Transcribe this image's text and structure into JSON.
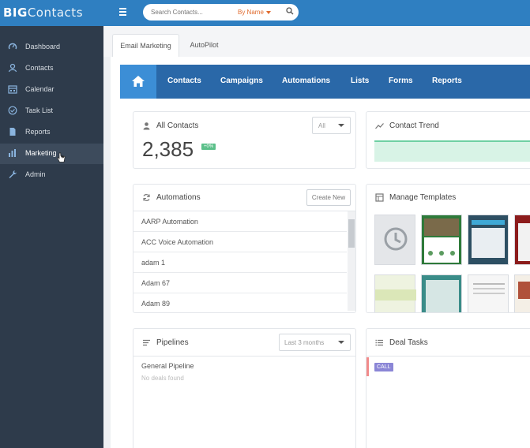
{
  "app": {
    "logo_bold": "BIG",
    "logo_rest": "Contacts"
  },
  "search": {
    "placeholder": "Search Contacts...",
    "by_label": "By Name"
  },
  "sidebar": {
    "items": [
      {
        "label": "Dashboard",
        "icon": "dashboard-icon"
      },
      {
        "label": "Contacts",
        "icon": "contacts-icon"
      },
      {
        "label": "Calendar",
        "icon": "calendar-icon"
      },
      {
        "label": "Task List",
        "icon": "task-check-icon"
      },
      {
        "label": "Reports",
        "icon": "document-icon"
      },
      {
        "label": "Marketing",
        "icon": "bar-chart-icon"
      },
      {
        "label": "Admin",
        "icon": "wrench-icon"
      }
    ],
    "active_index": 5
  },
  "tabs": [
    {
      "label": "Email Marketing",
      "active": true
    },
    {
      "label": "AutoPilot",
      "active": false
    }
  ],
  "marketing_nav": [
    "Contacts",
    "Campaigns",
    "Automations",
    "Lists",
    "Forms",
    "Reports"
  ],
  "all_contacts": {
    "title": "All Contacts",
    "filter": "All",
    "count": "2,385",
    "badge": "+0%"
  },
  "contact_trend": {
    "title": "Contact Trend"
  },
  "automations": {
    "title": "Automations",
    "create_label": "Create New",
    "items": [
      "AARP Automation",
      "ACC Voice Automation",
      "adam 1",
      "Adam 67",
      "Adam 89"
    ]
  },
  "templates": {
    "title": "Manage Templates"
  },
  "pipelines": {
    "title": "Pipelines",
    "range": "Last 3 months",
    "name": "General Pipeline",
    "empty": "No deals found"
  },
  "deal_tasks": {
    "title": "Deal Tasks",
    "badge": "CALL"
  },
  "colors": {
    "topbar": "#2f7fc1",
    "sidebar": "#2e3b4b",
    "nav": "#2a68a8",
    "home": "#3c8ed6",
    "accent_green": "#5cc08a"
  }
}
